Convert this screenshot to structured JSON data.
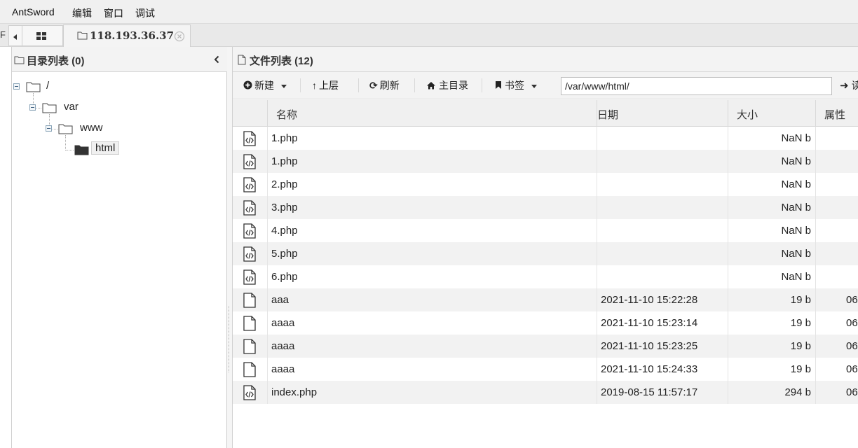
{
  "menu": {
    "items": [
      "AntSword",
      "编辑",
      "窗口",
      "调试"
    ]
  },
  "tabs": {
    "left_edge_char": "F",
    "active_tab_title": "118.193.36.37"
  },
  "left_panel": {
    "title": "目录列表 (0)",
    "tree": [
      {
        "label": "/",
        "depth": 0,
        "expanded": true
      },
      {
        "label": "var",
        "depth": 1,
        "expanded": true
      },
      {
        "label": "www",
        "depth": 2,
        "expanded": true
      },
      {
        "label": "html",
        "depth": 3,
        "selected": true
      }
    ]
  },
  "right_panel": {
    "title": "文件列表 (12)",
    "toolbar": {
      "new_label": "新建",
      "up_label": "上层",
      "refresh_label": "刷新",
      "home_label": "主目录",
      "bookmark_label": "书签",
      "path_value": "/var/www/html/",
      "go_label": "读"
    },
    "columns": [
      "名称",
      "日期",
      "大小",
      "属性"
    ],
    "files": [
      {
        "icon": "php-file-icon",
        "name": "1.php",
        "date": "",
        "size": "NaN b",
        "attr": ""
      },
      {
        "icon": "php-file-icon",
        "name": "1.php",
        "date": "",
        "size": "NaN b",
        "attr": ""
      },
      {
        "icon": "php-file-icon",
        "name": "2.php",
        "date": "",
        "size": "NaN b",
        "attr": ""
      },
      {
        "icon": "php-file-icon",
        "name": "3.php",
        "date": "",
        "size": "NaN b",
        "attr": ""
      },
      {
        "icon": "php-file-icon",
        "name": "4.php",
        "date": "",
        "size": "NaN b",
        "attr": ""
      },
      {
        "icon": "php-file-icon",
        "name": "5.php",
        "date": "",
        "size": "NaN b",
        "attr": ""
      },
      {
        "icon": "php-file-icon",
        "name": "6.php",
        "date": "",
        "size": "NaN b",
        "attr": ""
      },
      {
        "icon": "file-icon",
        "name": "aaa",
        "date": "2021-11-10 15:22:28",
        "size": "19 b",
        "attr": "06"
      },
      {
        "icon": "file-icon",
        "name": "aaaa",
        "date": "2021-11-10 15:23:14",
        "size": "19 b",
        "attr": "06"
      },
      {
        "icon": "file-icon",
        "name": "aaaa",
        "date": "2021-11-10 15:23:25",
        "size": "19 b",
        "attr": "06"
      },
      {
        "icon": "file-icon",
        "name": "aaaa",
        "date": "2021-11-10 15:24:33",
        "size": "19 b",
        "attr": "06"
      },
      {
        "icon": "php-file-icon",
        "name": "index.php",
        "date": "2019-08-15 11:57:17",
        "size": "294 b",
        "attr": "06"
      }
    ]
  }
}
